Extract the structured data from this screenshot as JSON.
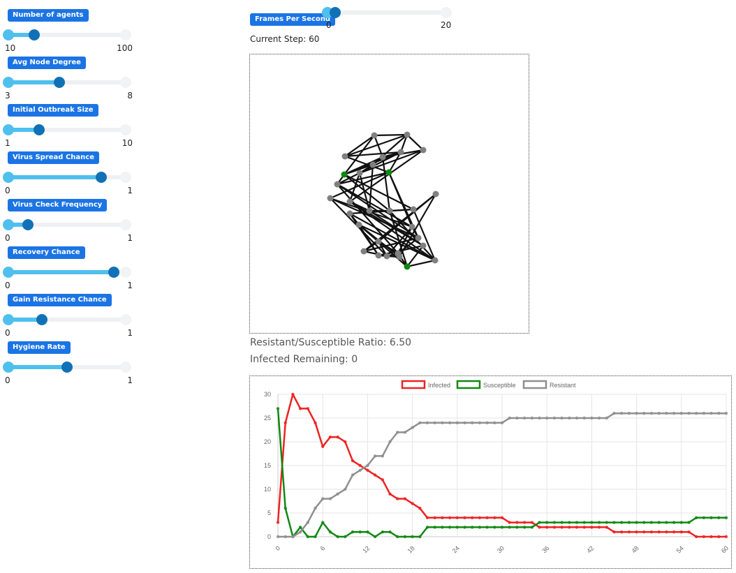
{
  "controls": {
    "sliders": [
      {
        "id": "agents",
        "label": "Number of agents",
        "min": "10",
        "max": "100",
        "value": 32
      },
      {
        "id": "degree",
        "label": "Avg Node Degree",
        "min": "3",
        "max": "8",
        "value": 5.2
      },
      {
        "id": "outbreak",
        "label": "Initial Outbreak Size",
        "min": "1",
        "max": "10",
        "value": 3.5
      },
      {
        "id": "spread",
        "label": "Virus Spread Chance",
        "min": "0",
        "max": "1",
        "value": 0.77
      },
      {
        "id": "check",
        "label": "Virus Check Frequency",
        "min": "0",
        "max": "1",
        "value": 0.19
      },
      {
        "id": "recovery",
        "label": "Recovery Chance",
        "min": "0",
        "max": "1",
        "value": 0.87
      },
      {
        "id": "resistance",
        "label": "Gain Resistance Chance",
        "min": "0",
        "max": "1",
        "value": 0.3
      },
      {
        "id": "hygiene",
        "label": "Hygiene Rate",
        "min": "0",
        "max": "1",
        "value": 0.5
      }
    ]
  },
  "fps": {
    "label": "Frames Per Second",
    "min": "0",
    "max": "20",
    "value": 2
  },
  "status": {
    "current_step": "Current Step: 60",
    "ratio": "Resistant/Susceptible Ratio: 6.50",
    "infected_remaining": "Infected Remaining: 0"
  },
  "network": {
    "colors": {
      "resistant": "#808080",
      "susceptible": "#0a8a0a",
      "edge": "#111111"
    },
    "nodes": [
      {
        "id": 0,
        "state": "resistant"
      },
      {
        "id": 1,
        "state": "resistant"
      },
      {
        "id": 2,
        "state": "resistant"
      },
      {
        "id": 3,
        "state": "resistant"
      },
      {
        "id": 4,
        "state": "resistant"
      },
      {
        "id": 5,
        "state": "resistant"
      },
      {
        "id": 6,
        "state": "susceptible"
      },
      {
        "id": 7,
        "state": "resistant"
      },
      {
        "id": 8,
        "state": "resistant"
      },
      {
        "id": 9,
        "state": "susceptible"
      },
      {
        "id": 10,
        "state": "resistant"
      },
      {
        "id": 11,
        "state": "resistant"
      },
      {
        "id": 12,
        "state": "resistant"
      },
      {
        "id": 13,
        "state": "resistant"
      },
      {
        "id": 14,
        "state": "resistant"
      },
      {
        "id": 15,
        "state": "resistant"
      },
      {
        "id": 16,
        "state": "resistant"
      },
      {
        "id": 17,
        "state": "resistant"
      },
      {
        "id": 18,
        "state": "resistant"
      },
      {
        "id": 19,
        "state": "resistant"
      },
      {
        "id": 20,
        "state": "susceptible"
      },
      {
        "id": 21,
        "state": "resistant"
      },
      {
        "id": 22,
        "state": "resistant"
      },
      {
        "id": 23,
        "state": "resistant"
      },
      {
        "id": 24,
        "state": "resistant"
      },
      {
        "id": 25,
        "state": "resistant"
      },
      {
        "id": 26,
        "state": "resistant"
      },
      {
        "id": 27,
        "state": "resistant"
      },
      {
        "id": 28,
        "state": "resistant"
      },
      {
        "id": 29,
        "state": "resistant"
      }
    ],
    "edges": [
      [
        0,
        1
      ],
      [
        0,
        4
      ],
      [
        0,
        2
      ],
      [
        1,
        2
      ],
      [
        1,
        5
      ],
      [
        2,
        3
      ],
      [
        2,
        7
      ],
      [
        3,
        8
      ],
      [
        3,
        12
      ],
      [
        3,
        2
      ],
      [
        4,
        5
      ],
      [
        4,
        6
      ],
      [
        4,
        10
      ],
      [
        5,
        7
      ],
      [
        5,
        9
      ],
      [
        6,
        10
      ],
      [
        6,
        11
      ],
      [
        6,
        16
      ],
      [
        7,
        8
      ],
      [
        7,
        13
      ],
      [
        8,
        12
      ],
      [
        9,
        10
      ],
      [
        9,
        14
      ],
      [
        9,
        15
      ],
      [
        10,
        16
      ],
      [
        11,
        16
      ],
      [
        11,
        17
      ],
      [
        12,
        13
      ],
      [
        12,
        18
      ],
      [
        13,
        14
      ],
      [
        13,
        18
      ],
      [
        14,
        15
      ],
      [
        14,
        20
      ],
      [
        15,
        19
      ],
      [
        16,
        21
      ],
      [
        16,
        22
      ],
      [
        17,
        21
      ],
      [
        17,
        24
      ],
      [
        18,
        20
      ],
      [
        18,
        23
      ],
      [
        19,
        20
      ],
      [
        19,
        25
      ],
      [
        20,
        21
      ],
      [
        20,
        26
      ],
      [
        21,
        22
      ],
      [
        22,
        27
      ],
      [
        22,
        28
      ],
      [
        23,
        26
      ],
      [
        23,
        25
      ],
      [
        24,
        27
      ],
      [
        24,
        29
      ],
      [
        25,
        26
      ],
      [
        26,
        28
      ],
      [
        27,
        29
      ],
      [
        28,
        29
      ],
      [
        1,
        9
      ],
      [
        0,
        6
      ],
      [
        4,
        9
      ],
      [
        5,
        14
      ],
      [
        8,
        13
      ],
      [
        10,
        17
      ],
      [
        11,
        22
      ],
      [
        15,
        25
      ],
      [
        19,
        26
      ],
      [
        21,
        27
      ],
      [
        3,
        5
      ],
      [
        12,
        19
      ],
      [
        7,
        9
      ],
      [
        2,
        4
      ],
      [
        16,
        17
      ],
      [
        23,
        28
      ],
      [
        14,
        19
      ],
      [
        6,
        17
      ],
      [
        22,
        24
      ],
      [
        10,
        21
      ]
    ]
  },
  "chart_data": {
    "type": "line",
    "x": [
      0,
      1,
      2,
      3,
      4,
      5,
      6,
      7,
      8,
      9,
      10,
      11,
      12,
      13,
      14,
      15,
      16,
      17,
      18,
      19,
      20,
      21,
      22,
      23,
      24,
      25,
      26,
      27,
      28,
      29,
      30,
      31,
      32,
      33,
      34,
      35,
      36,
      37,
      38,
      39,
      40,
      41,
      42,
      43,
      44,
      45,
      46,
      47,
      48,
      49,
      50,
      51,
      52,
      53,
      54,
      55,
      56,
      57,
      58,
      59,
      60
    ],
    "x_ticks": [
      "0",
      "6",
      "12",
      "18",
      "24",
      "30",
      "36",
      "42",
      "48",
      "54",
      "60"
    ],
    "y_ticks": [
      "0",
      "5",
      "10",
      "15",
      "20",
      "25",
      "30"
    ],
    "ylim": [
      0,
      30
    ],
    "series": [
      {
        "name": "Infected",
        "color": "#ee2222",
        "values": [
          3,
          24,
          30,
          27,
          27,
          24,
          19,
          21,
          21,
          20,
          16,
          15,
          14,
          13,
          12,
          9,
          8,
          8,
          7,
          6,
          4,
          4,
          4,
          4,
          4,
          4,
          4,
          4,
          4,
          4,
          4,
          3,
          3,
          3,
          3,
          2,
          2,
          2,
          2,
          2,
          2,
          2,
          2,
          2,
          2,
          1,
          1,
          1,
          1,
          1,
          1,
          1,
          1,
          1,
          1,
          1,
          0,
          0,
          0,
          0,
          0
        ]
      },
      {
        "name": "Susceptible",
        "color": "#118811",
        "values": [
          27,
          6,
          0,
          2,
          0,
          0,
          3,
          1,
          0,
          0,
          1,
          1,
          1,
          0,
          1,
          1,
          0,
          0,
          0,
          0,
          2,
          2,
          2,
          2,
          2,
          2,
          2,
          2,
          2,
          2,
          2,
          2,
          2,
          2,
          2,
          3,
          3,
          3,
          3,
          3,
          3,
          3,
          3,
          3,
          3,
          3,
          3,
          3,
          3,
          3,
          3,
          3,
          3,
          3,
          3,
          3,
          4,
          4,
          4,
          4,
          4
        ]
      },
      {
        "name": "Resistant",
        "color": "#8f8f8f",
        "values": [
          0,
          0,
          0,
          1,
          3,
          6,
          8,
          8,
          9,
          10,
          13,
          14,
          15,
          17,
          17,
          20,
          22,
          22,
          23,
          24,
          24,
          24,
          24,
          24,
          24,
          24,
          24,
          24,
          24,
          24,
          24,
          25,
          25,
          25,
          25,
          25,
          25,
          25,
          25,
          25,
          25,
          25,
          25,
          25,
          25,
          26,
          26,
          26,
          26,
          26,
          26,
          26,
          26,
          26,
          26,
          26,
          26,
          26,
          26,
          26,
          26
        ]
      }
    ]
  }
}
